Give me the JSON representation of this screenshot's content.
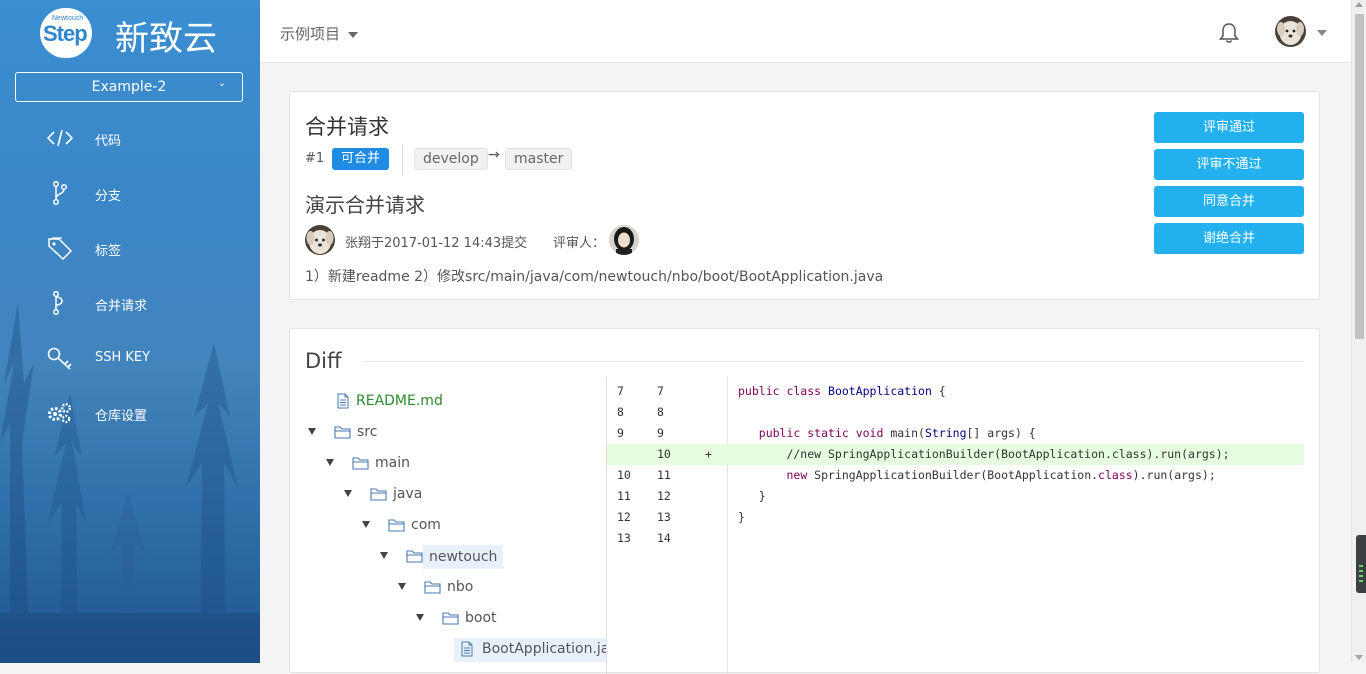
{
  "sidebar": {
    "logo_small": "Newtouch",
    "logo_text": "Step",
    "brand": "新致云",
    "project": "Example-2",
    "items": [
      {
        "label": "代码"
      },
      {
        "label": "分支"
      },
      {
        "label": "标签"
      },
      {
        "label": "合并请求"
      },
      {
        "label": "SSH KEY"
      },
      {
        "label": "仓库设置"
      }
    ]
  },
  "topbar": {
    "project_switch": "示例项目"
  },
  "mr": {
    "title": "合并请求",
    "id": "#1",
    "status": "可合并",
    "source_branch": "develop",
    "arrow": "→",
    "target_branch": "master",
    "desc_title": "演示合并请求",
    "author_text": "张翔于2017-01-12 14:43提交",
    "reviewer_label": "评审人：",
    "body": "1）新建readme 2）修改src/main/java/com/newtouch/nbo/boot/BootApplication.java",
    "buttons": {
      "approve": "评审通过",
      "reject": "评审不通过",
      "merge": "同意合并",
      "decline": "谢绝合并"
    }
  },
  "diff": {
    "title": "Diff",
    "tree": [
      {
        "name": "README.md"
      },
      {
        "name": "src"
      },
      {
        "name": "main"
      },
      {
        "name": "java"
      },
      {
        "name": "com"
      },
      {
        "name": "newtouch"
      },
      {
        "name": "nbo"
      },
      {
        "name": "boot"
      },
      {
        "name": "BootApplication.ja"
      }
    ],
    "lines": [
      {
        "old": "7",
        "new": "7",
        "mark": "",
        "text": "public class BootApplication {"
      },
      {
        "old": "8",
        "new": "8",
        "mark": "",
        "text": ""
      },
      {
        "old": "9",
        "new": "9",
        "mark": "",
        "text": "   public static void main(String[] args) {"
      },
      {
        "old": "",
        "new": "10",
        "mark": "+",
        "text": "       //new SpringApplicationBuilder(BootApplication.class).run(args);"
      },
      {
        "old": "10",
        "new": "11",
        "mark": "",
        "text": "       new SpringApplicationBuilder(BootApplication.class).run(args);"
      },
      {
        "old": "11",
        "new": "12",
        "mark": "",
        "text": "   }"
      },
      {
        "old": "12",
        "new": "13",
        "mark": "",
        "text": "}"
      },
      {
        "old": "13",
        "new": "14",
        "mark": "",
        "text": ""
      }
    ]
  },
  "colors": {
    "sidebar": "#3b86c7",
    "accent": "#22b0ee",
    "status": "#1f8be3",
    "added_line": "#e6fde0"
  }
}
